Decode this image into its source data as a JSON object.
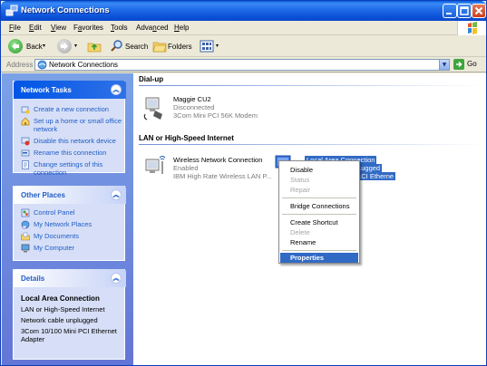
{
  "window": {
    "title": "Network Connections"
  },
  "menu": {
    "items": [
      {
        "pre": "",
        "u": "F",
        "post": "ile"
      },
      {
        "pre": "",
        "u": "E",
        "post": "dit"
      },
      {
        "pre": "",
        "u": "V",
        "post": "iew"
      },
      {
        "pre": "F",
        "u": "a",
        "post": "vorites"
      },
      {
        "pre": "",
        "u": "T",
        "post": "ools"
      },
      {
        "pre": "Adva",
        "u": "n",
        "post": "ced"
      },
      {
        "pre": "",
        "u": "H",
        "post": "elp"
      }
    ]
  },
  "toolbar": {
    "back": "Back",
    "search": "Search",
    "folders": "Folders"
  },
  "address": {
    "label": "Address",
    "value": "Network Connections",
    "go": "Go"
  },
  "tasks": {
    "network": {
      "title": "Network Tasks",
      "items": [
        "Create a new connection",
        "Set up a home or small office network",
        "Disable this network device",
        "Rename this connection",
        "Change settings of this connection"
      ]
    },
    "places": {
      "title": "Other Places",
      "items": [
        "Control Panel",
        "My Network Places",
        "My Documents",
        "My Computer"
      ]
    },
    "details": {
      "title": "Details",
      "name": "Local Area Connection",
      "type": "LAN or High-Speed Internet",
      "status": "Network cable unplugged",
      "device": "3Com 10/100 Mini PCI Ethernet Adapter"
    }
  },
  "groups": {
    "dialup": {
      "title": "Dial-up",
      "conn": {
        "name": "Maggie CU2",
        "status": "Disconnected",
        "device": "3Com Mini PCI 56K Modem"
      }
    },
    "lan": {
      "title": "LAN or High-Speed Internet",
      "wireless": {
        "name": "Wireless Network Connection",
        "status": "Enabled",
        "device": "IBM High Rate Wireless LAN P..."
      },
      "local": {
        "name": "Local Area Connection",
        "status": "...ugged",
        "device": "...CI Etherne"
      }
    }
  },
  "context_menu": {
    "disable": "Disable",
    "status": "Status",
    "repair": "Repair",
    "bridge": "Bridge Connections",
    "shortcut": "Create Shortcut",
    "delete": "Delete",
    "rename": "Rename",
    "properties": "Properties"
  },
  "colors": {
    "title_bar": "#1f6ae8",
    "selection": "#316ac5",
    "link": "#215dc6",
    "panel": "#6f8fd8"
  }
}
